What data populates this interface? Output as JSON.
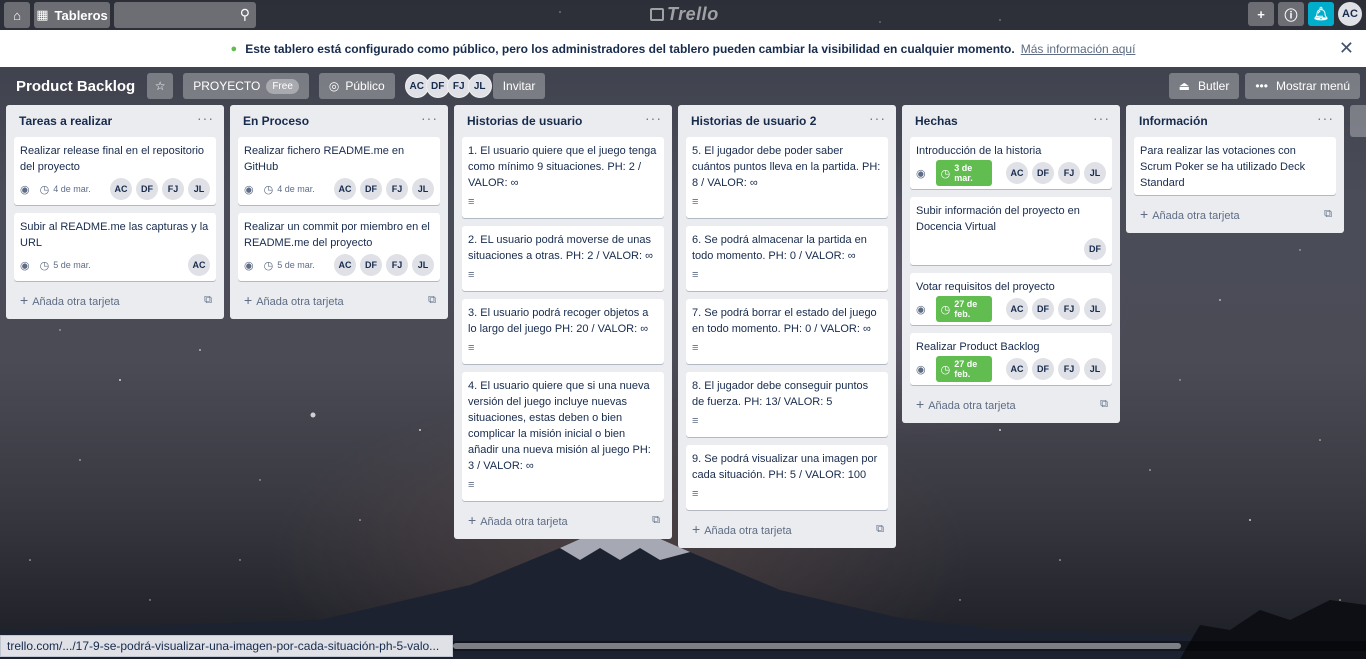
{
  "header": {
    "boards_label": "Tableros",
    "logo_text": "Trello",
    "user_initials": "AC"
  },
  "notice": {
    "message": "Este tablero está configurado como público, pero los administradores del tablero pueden cambiar la visibilidad en cualquier momento.",
    "more_link": "Más información aquí"
  },
  "board": {
    "title": "Product Backlog",
    "team_label": "PROYECTO",
    "free_badge": "Free",
    "visibility_label": "Público",
    "members": [
      "AC",
      "DF",
      "FJ",
      "JL"
    ],
    "invite_label": "Invitar",
    "butler_label": "Butler",
    "show_menu_label": "Mostrar menú"
  },
  "add_card_label": "Añada otra tarjeta",
  "lists": [
    {
      "title": "Tareas a realizar",
      "cards": [
        {
          "text": "Realizar release final en el repositorio del proyecto",
          "watch": true,
          "date": "4 de mar.",
          "members": [
            "AC",
            "DF",
            "FJ",
            "JL"
          ]
        },
        {
          "text": "Subir al README.me las capturas y la URL",
          "watch": true,
          "date": "5 de mar.",
          "members": [
            "AC"
          ]
        }
      ]
    },
    {
      "title": "En Proceso",
      "cards": [
        {
          "text": "Realizar fichero README.me en GitHub",
          "watch": true,
          "date": "4 de mar.",
          "members": [
            "AC",
            "DF",
            "FJ",
            "JL"
          ]
        },
        {
          "text": "Realizar un commit por miembro en el README.me del proyecto",
          "watch": true,
          "date": "5 de mar.",
          "members": [
            "AC",
            "DF",
            "FJ",
            "JL"
          ]
        }
      ]
    },
    {
      "title": "Historias de usuario",
      "cards": [
        {
          "text": "1. El usuario quiere que el juego tenga como mínimo 9 situaciones. PH: 2 / VALOR: ∞",
          "desc": true
        },
        {
          "text": "2. EL usuario podrá moverse de unas situaciones a otras. PH: 2 / VALOR: ∞",
          "desc": true
        },
        {
          "text": "3. El usuario podrá recoger objetos a lo largo del juego PH: 20 / VALOR: ∞",
          "desc": true
        },
        {
          "text": "4. El usuario quiere que si una nueva versión del juego incluye nuevas situaciones, estas deben o bien complicar la misión inicial o bien añadir una nueva misión al juego PH: 3 / VALOR: ∞",
          "desc": true
        }
      ]
    },
    {
      "title": "Historias de usuario 2",
      "cards": [
        {
          "text": "5. El jugador debe poder saber cuántos puntos lleva en la partida. PH: 8 / VALOR: ∞",
          "desc": true
        },
        {
          "text": "6. Se podrá almacenar la partida en todo momento. PH: 0 / VALOR: ∞",
          "desc": true
        },
        {
          "text": "7. Se podrá borrar el estado del juego en todo momento. PH: 0 / VALOR: ∞",
          "desc": true
        },
        {
          "text": "8. El jugador debe conseguir puntos de fuerza. PH: 13/ VALOR: 5",
          "desc": true
        },
        {
          "text": "9. Se podrá visualizar una imagen por cada situación. PH: 5 / VALOR: 100",
          "desc": true
        }
      ]
    },
    {
      "title": "Hechas",
      "cards": [
        {
          "text": "Introducción de la historia",
          "watch": true,
          "due": "3 de mar.",
          "members": [
            "AC",
            "DF",
            "FJ",
            "JL"
          ]
        },
        {
          "text": "Subir información del proyecto en Docencia Virtual",
          "members": [
            "DF"
          ]
        },
        {
          "text": "Votar requisitos del proyecto",
          "watch": true,
          "due": "27 de feb.",
          "members": [
            "AC",
            "DF",
            "FJ",
            "JL"
          ]
        },
        {
          "text": "Realizar Product Backlog",
          "watch": true,
          "due": "27 de feb.",
          "members": [
            "AC",
            "DF",
            "FJ",
            "JL"
          ]
        }
      ]
    },
    {
      "title": "Información",
      "cards": [
        {
          "text": "Para realizar las votaciones con Scrum Poker se ha utilizado Deck Standard"
        }
      ]
    }
  ],
  "status_url": "trello.com/.../17-9-se-podrá-visualizar-una-imagen-por-cada-situación-ph-5-valo...",
  "colors": {
    "due_green": "#61bd4f",
    "bell_blue": "#00aecc",
    "list_bg": "#ebecf0"
  }
}
